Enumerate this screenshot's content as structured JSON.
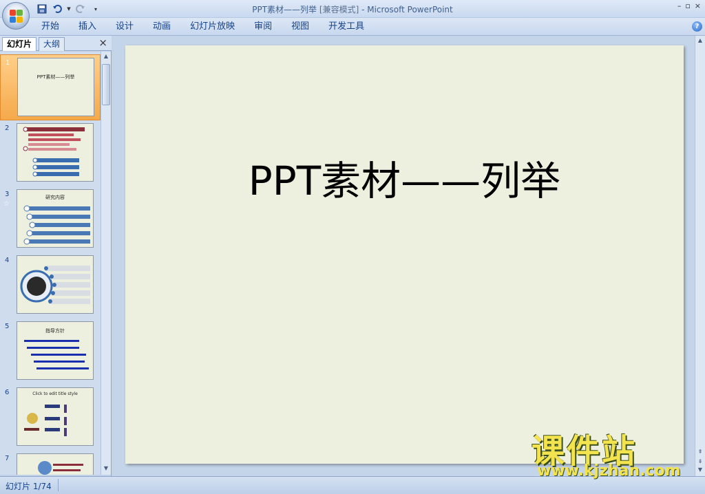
{
  "window": {
    "title": "PPT素材——列举",
    "mode": "[兼容模式]",
    "app": "Microsoft PowerPoint",
    "controls": [
      "–",
      "▫",
      "×"
    ]
  },
  "qat": [
    "save-icon",
    "undo-icon",
    "redo-icon",
    "customize-icon"
  ],
  "ribbon": {
    "tabs": [
      "开始",
      "插入",
      "设计",
      "动画",
      "幻灯片放映",
      "审阅",
      "视图",
      "开发工具"
    ],
    "help": "?"
  },
  "left_pane": {
    "tabs": [
      "幻灯片",
      "大纲"
    ],
    "close": "×",
    "thumbnails": [
      {
        "num": "1",
        "title": "PPT素材——列举",
        "selected": true
      },
      {
        "num": "2",
        "title": "",
        "selected": false
      },
      {
        "num": "3",
        "title": "研究内容",
        "selected": false,
        "star": "☆"
      },
      {
        "num": "4",
        "title": "",
        "selected": false
      },
      {
        "num": "5",
        "title": "指导方针",
        "selected": false
      },
      {
        "num": "6",
        "title": "Click to edit title style",
        "selected": false
      },
      {
        "num": "7",
        "title": "",
        "selected": false
      }
    ]
  },
  "slide": {
    "title": "PPT素材——列举",
    "background": "#eef0df"
  },
  "status": {
    "slide_info": "幻灯片 1/74"
  },
  "watermark": {
    "main": "课件站",
    "url": "www.kjzhan.com"
  }
}
